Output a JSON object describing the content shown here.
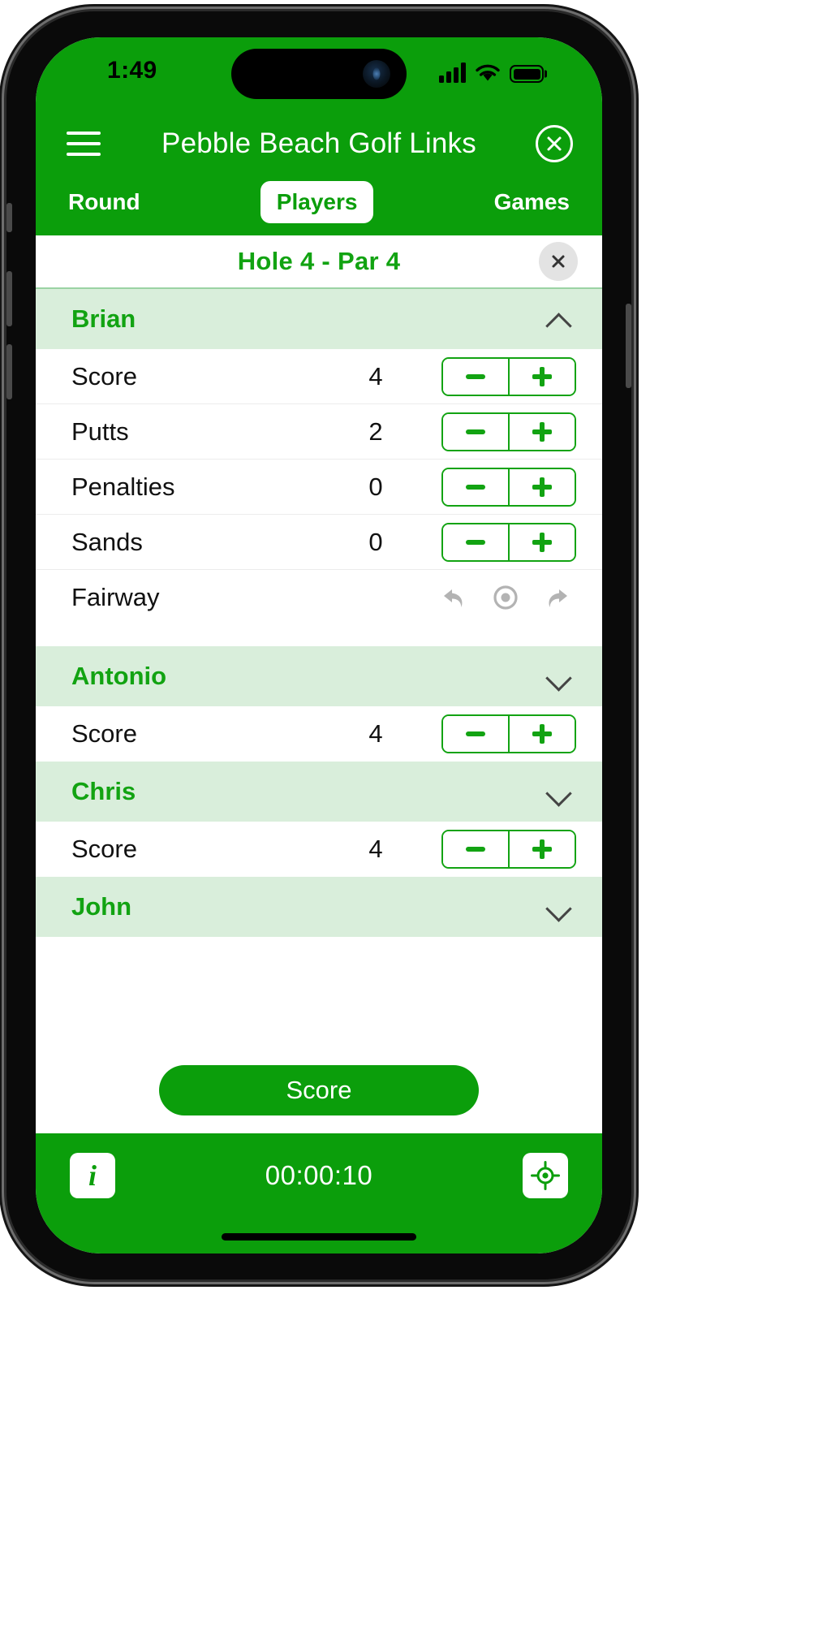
{
  "status_bar": {
    "time": "1:49",
    "signal_icon": "cellular-signal-icon",
    "wifi_icon": "wifi-icon",
    "battery_icon": "battery-icon"
  },
  "header": {
    "menu_icon": "hamburger-menu-icon",
    "title": "Pebble Beach Golf Links",
    "close_icon": "close-circle-icon",
    "brand_green": "#0b9e0b"
  },
  "tabs": [
    {
      "label": "Round",
      "selected": false
    },
    {
      "label": "Players",
      "selected": true
    },
    {
      "label": "Games",
      "selected": false
    }
  ],
  "hole_bar": {
    "title": "Hole 4  -  Par 4",
    "close_icon": "close-icon",
    "title_color": "#12a312"
  },
  "players": [
    {
      "name": "Brian",
      "expanded": true,
      "chevron": "chevron-up-icon",
      "stats": [
        {
          "label": "Score",
          "value": "4",
          "control": "stepper"
        },
        {
          "label": "Putts",
          "value": "2",
          "control": "stepper"
        },
        {
          "label": "Penalties",
          "value": "0",
          "control": "stepper"
        },
        {
          "label": "Sands",
          "value": "0",
          "control": "stepper"
        },
        {
          "label": "Fairway",
          "value": "",
          "control": "fairway-icons"
        }
      ]
    },
    {
      "name": "Antonio",
      "expanded": false,
      "chevron": "chevron-down-icon",
      "stats": [
        {
          "label": "Score",
          "value": "4",
          "control": "stepper"
        }
      ]
    },
    {
      "name": "Chris",
      "expanded": false,
      "chevron": "chevron-down-icon",
      "stats": [
        {
          "label": "Score",
          "value": "4",
          "control": "stepper"
        }
      ]
    },
    {
      "name": "John",
      "expanded": false,
      "chevron": "chevron-down-icon",
      "stats": []
    }
  ],
  "stepper": {
    "decrement_icon": "minus-icon",
    "increment_icon": "plus-icon",
    "border_color": "#12a312"
  },
  "fairway": {
    "left_icon": "arrow-left-miss-icon",
    "center_icon": "target-hit-icon",
    "right_icon": "arrow-right-miss-icon",
    "icon_color": "#b3b3b3"
  },
  "score_button": {
    "label": "Score",
    "color": "#0b9e0b"
  },
  "bottom_bar": {
    "info_icon": "info-icon",
    "info_label": "i",
    "timer": "00:00:10",
    "gps_icon": "gps-target-icon"
  }
}
